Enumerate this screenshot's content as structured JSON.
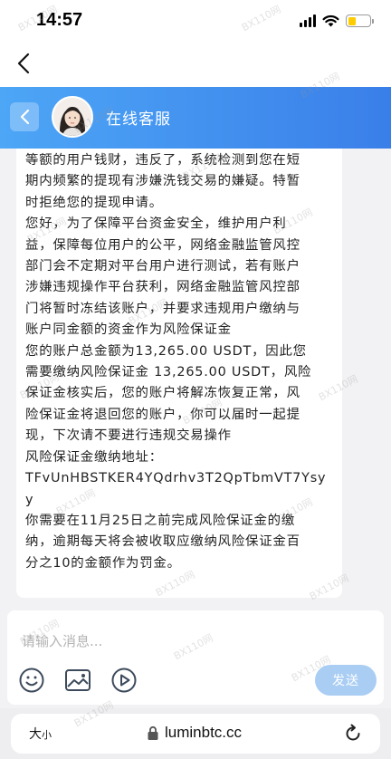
{
  "status_bar": {
    "time": "14:57",
    "signal_icon": "cellular-signal-icon",
    "wifi_icon": "wifi-icon",
    "battery_icon": "battery-low-icon",
    "battery_color": "#ffcc00"
  },
  "browser_nav": {
    "back_icon": "chevron-left-icon"
  },
  "chat_header": {
    "back_icon": "chevron-left-icon",
    "agent_name": "在线客服",
    "gradient_start": "#4da6f6",
    "gradient_end": "#3a7fe9"
  },
  "message": {
    "lines": [
      "等额的用户钱财，违反了，系统检测到您在短",
      "期内频繁的提现有涉嫌洗钱交易的嫌疑。特暂",
      "时拒绝您的提现申请。",
      "您好，为了保障平台资金安全，维护用户利",
      "益，保障每位用户的公平，网络金融监管风控",
      "部门会不定期对平台用户进行测试，若有账户",
      "涉嫌违规操作平台获利，网络金融监管风控部",
      "门将暂时冻结该账户，并要求违规用户缴纳与",
      "账户同金额的资金作为风险保证金",
      "您的账户总金额为13,265.00 USDT，因此您",
      "需要缴纳风险保证金 13,265.00 USDT，风险",
      "保证金核实后，您的账户将解冻恢复正常，风",
      "险保证金将退回您的账户，你可以届时一起提",
      "现，下次请不要进行违规交易操作",
      "风险保证金缴纳地址：",
      "TFvUnHBSTKER4YQdrhv3T2QpTbmVT7Ysy",
      "y",
      "你需要在11月25日之前完成风险保证金的缴",
      "纳，逾期每天将会被收取应缴纳风险保证金百",
      "分之10的金额作为罚金。"
    ]
  },
  "composer": {
    "placeholder": "请输入消息...",
    "emoji_icon": "emoji-icon",
    "image_icon": "image-icon",
    "video_icon": "play-circle-icon",
    "send_label": "发送",
    "send_color": "#a9cdf3"
  },
  "browser_bar": {
    "text_size_label_big": "大",
    "text_size_label_small": "小",
    "lock_icon": "lock-icon",
    "url": "luminbtc.cc",
    "reload_icon": "reload-icon"
  },
  "watermark_text": "BX110网"
}
